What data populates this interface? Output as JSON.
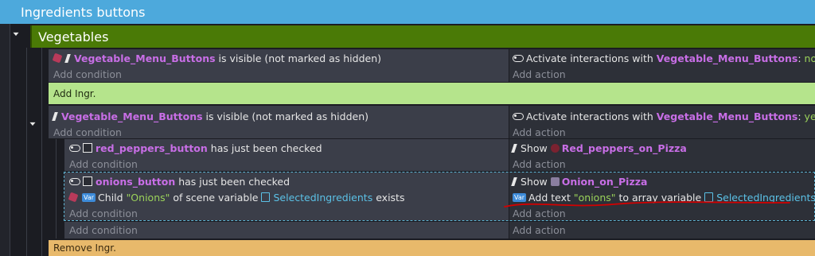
{
  "group": {
    "title": "Ingredients buttons"
  },
  "subgroup": {
    "title": "Vegetables"
  },
  "event1": {
    "cond_object": "Vegetable_Menu_Buttons",
    "cond_text": "is visible (not marked as hidden)",
    "add_condition": "Add condition",
    "act_prefix": "Activate interactions with",
    "act_object": "Vegetable_Menu_Buttons",
    "act_colon": ":",
    "act_value": "no",
    "add_action": "Add action"
  },
  "comment_add": "Add Ingr.",
  "event2": {
    "cond_object": "Vegetable_Menu_Buttons",
    "cond_text": "is visible (not marked as hidden)",
    "add_condition": "Add condition",
    "act_prefix": "Activate interactions with",
    "act_object": "Vegetable_Menu_Buttons",
    "act_colon": ":",
    "act_value": "yes",
    "add_action": "Add action"
  },
  "sub1": {
    "cond_object": "red_peppers_button",
    "cond_text": "has just been checked",
    "add_condition": "Add condition",
    "act_show": "Show",
    "act_object": "Red_peppers_on_Pizza",
    "add_action": "Add action"
  },
  "sub2": {
    "cond_object": "onions_button",
    "cond_text": "has just been checked",
    "cond2_prefix": "Child",
    "cond2_value": "\"Onions\"",
    "cond2_mid": "of scene variable",
    "cond2_var": "SelectedIngredients",
    "cond2_suffix": "exists",
    "add_condition": "Add condition",
    "act_show": "Show",
    "act_object": "Onion_on_Pizza",
    "act2_prefix": "Add text",
    "act2_value": "\"onions\"",
    "act2_mid": "to array variable",
    "act2_var": "SelectedIngredients",
    "add_action": "Add action"
  },
  "footer_add_condition": "Add condition",
  "footer_add_action": "Add action",
  "comment_remove": "Remove Ingr.",
  "colors": {
    "group": "#4da9dc",
    "subgroup": "#4a7a06",
    "comment_green": "#b5e48c",
    "comment_orange": "#e8b96b",
    "object": "#c86ee6",
    "value": "#9bd35a",
    "variable": "#5bc1e6",
    "annotation": "#d40000"
  }
}
